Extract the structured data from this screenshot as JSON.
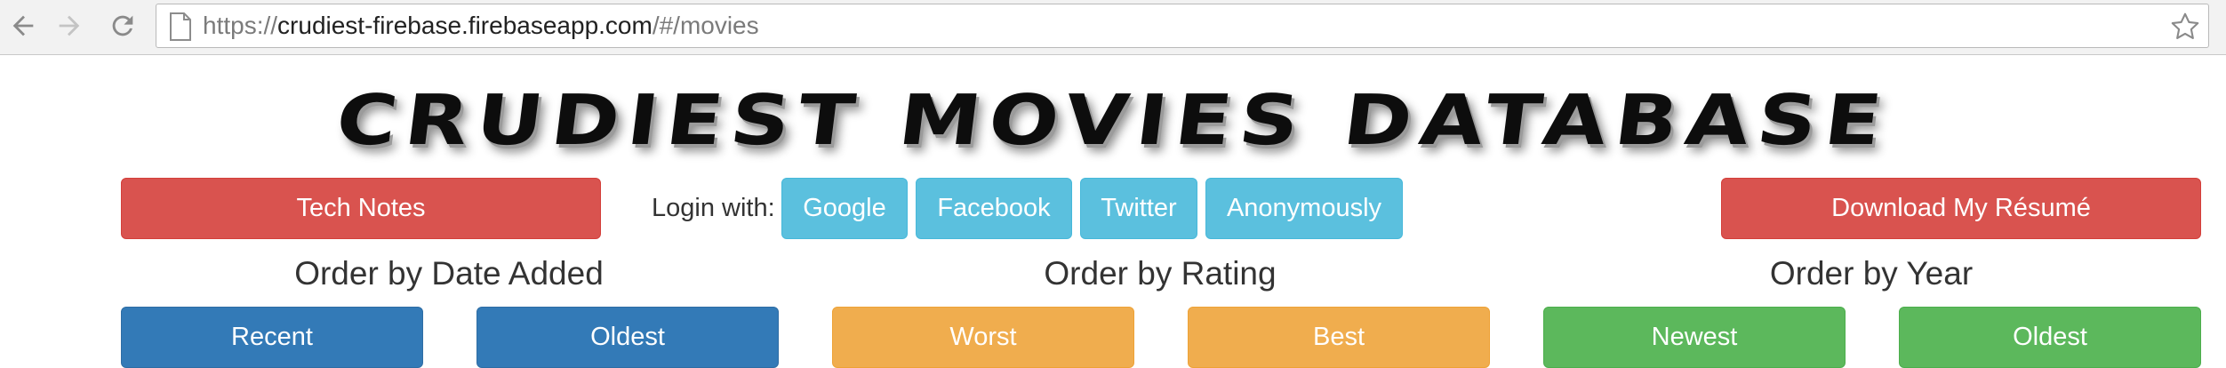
{
  "browser": {
    "url_scheme": "https://",
    "url_host": "crudiest-firebase.firebaseapp.com",
    "url_path": "/#/movies",
    "icons": [
      "back-arrow-icon",
      "forward-arrow-icon",
      "reload-icon",
      "page-icon",
      "bookmark-star-icon"
    ]
  },
  "header": {
    "title": "Crudiest Movies Database"
  },
  "toolbar": {
    "tech_notes_label": "Tech Notes",
    "login_label": "Login with:",
    "login_providers": [
      "Google",
      "Facebook",
      "Twitter",
      "Anonymously"
    ],
    "resume_label": "Download My Résumé"
  },
  "ordering": {
    "date": {
      "heading": "Order by Date Added",
      "buttons": [
        "Recent",
        "Oldest"
      ]
    },
    "rating": {
      "heading": "Order by Rating",
      "buttons": [
        "Worst",
        "Best"
      ]
    },
    "year": {
      "heading": "Order by Year",
      "buttons": [
        "Newest",
        "Oldest"
      ]
    }
  },
  "colors": {
    "danger": "#d9534f",
    "info": "#5bc0de",
    "primary": "#337ab7",
    "warning": "#f0ad4e",
    "success": "#5cb85c"
  }
}
